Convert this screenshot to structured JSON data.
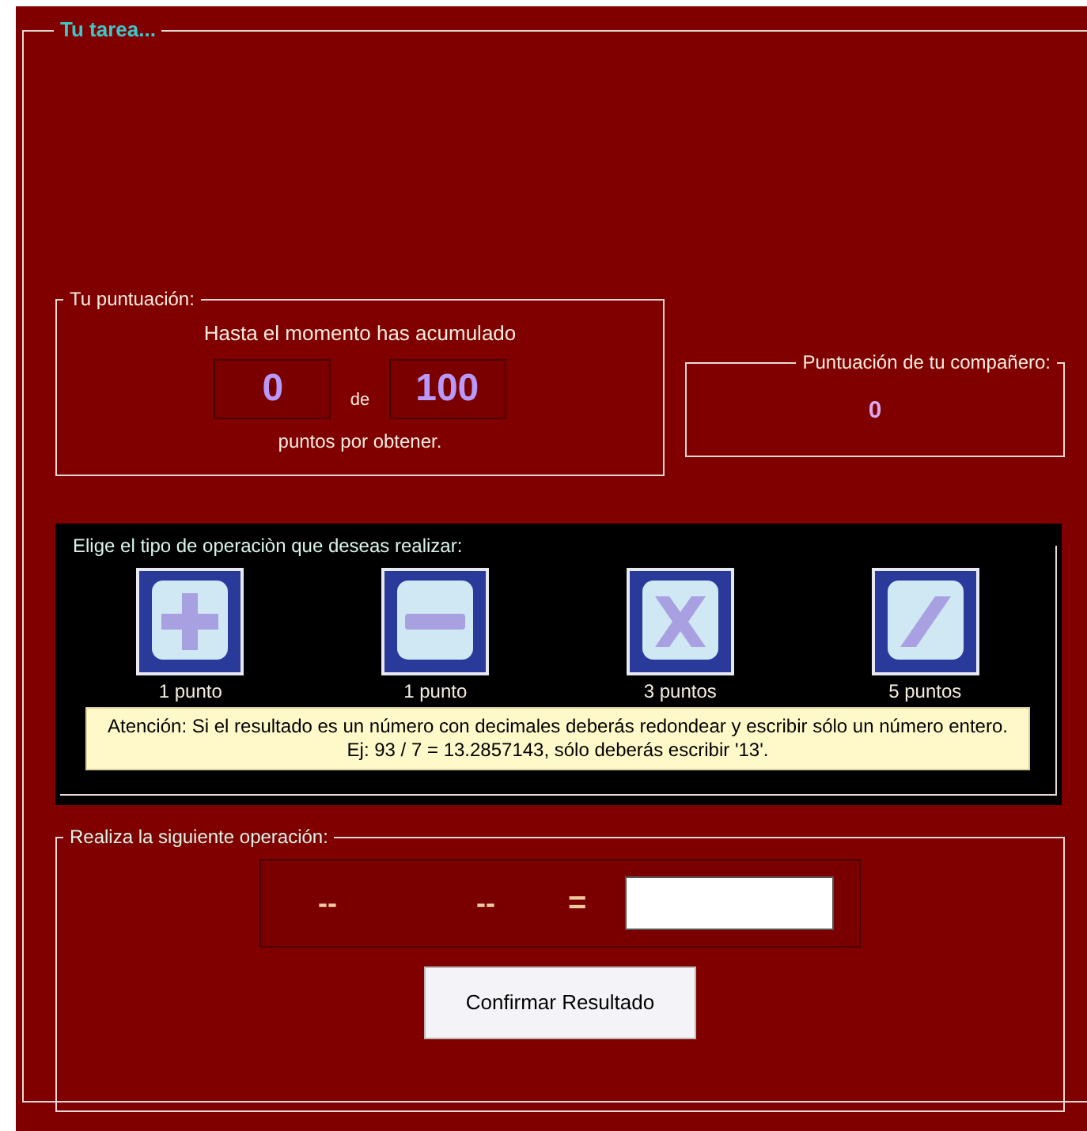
{
  "task_group": {
    "title": "Tu tarea..."
  },
  "score": {
    "title": "Tu puntuación:",
    "intro": "Hasta el momento has acumulado",
    "current": "0",
    "separator": "de",
    "target": "100",
    "suffix": "puntos por obtener."
  },
  "partner": {
    "title": "Puntuación de tu compañero:",
    "value": "0"
  },
  "operations": {
    "title": "Elige el tipo de operaciòn que deseas realizar:",
    "items": [
      {
        "kind": "add",
        "points": "1 punto"
      },
      {
        "kind": "subtract",
        "points": "1 punto"
      },
      {
        "kind": "multiply",
        "points": "3 puntos"
      },
      {
        "kind": "divide",
        "points": "5 puntos"
      }
    ],
    "notice": "Atención: Si el resultado es un número con decimales deberás redondear y escribir sólo un número entero. Ej: 93 / 7 = 13.2857143, sólo deberás escribir '13'."
  },
  "exercise": {
    "title": "Realiza la siguiente operación:",
    "operand_1": "--",
    "operand_2": "--",
    "equals": "=",
    "button": "Confirmar Resultado"
  }
}
